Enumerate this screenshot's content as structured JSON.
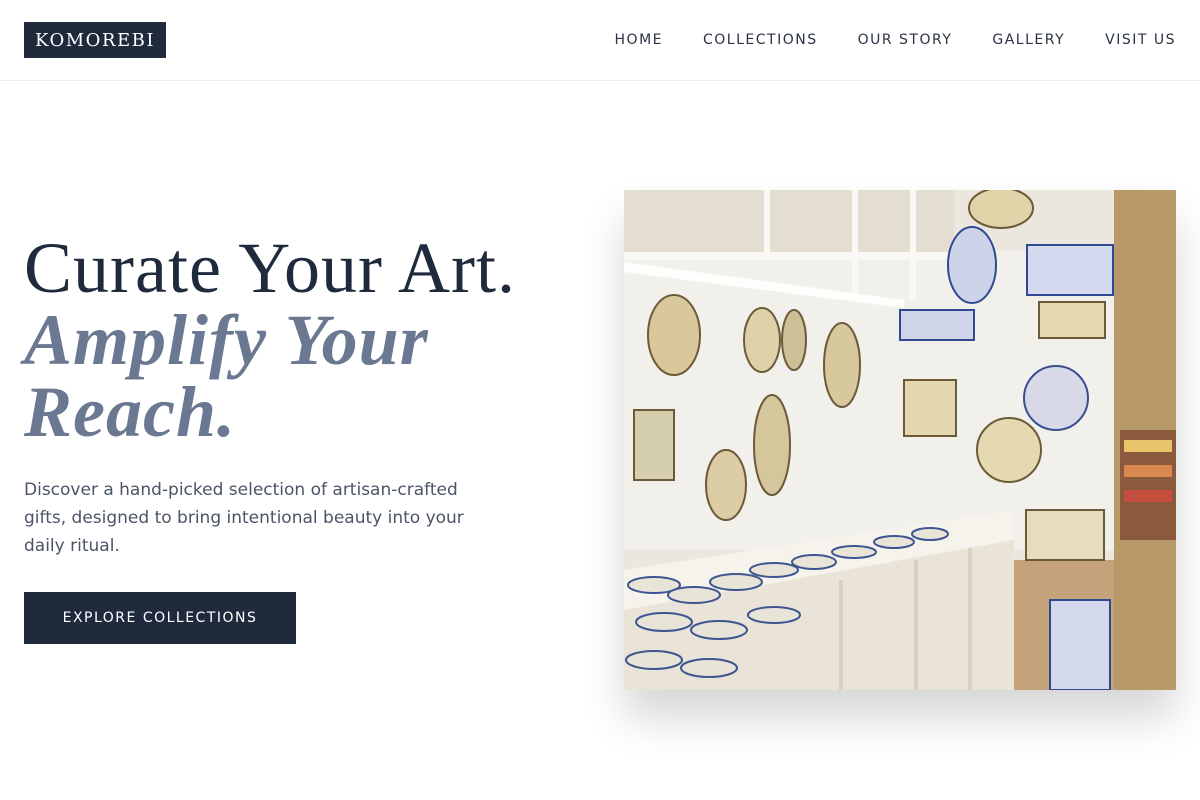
{
  "brand": {
    "logo_text": "KOMOREBI"
  },
  "nav": {
    "items": [
      {
        "label": "HOME"
      },
      {
        "label": "COLLECTIONS"
      },
      {
        "label": "OUR STORY"
      },
      {
        "label": "GALLERY"
      },
      {
        "label": "VISIT US"
      }
    ]
  },
  "hero": {
    "title_line1": "Curate Your Art.",
    "title_line2": "Amplify Your Reach.",
    "description": "Discover a hand-picked selection of artisan-crafted gifts, designed to bring intentional beauty into your daily ritual.",
    "cta_label": "EXPLORE COLLECTIONS"
  },
  "colors": {
    "primary": "#1f2a3d",
    "accent_slate": "#6a7891",
    "body_text": "#4b5566"
  },
  "image": {
    "description_icon": "ceramics-shop-photo"
  }
}
